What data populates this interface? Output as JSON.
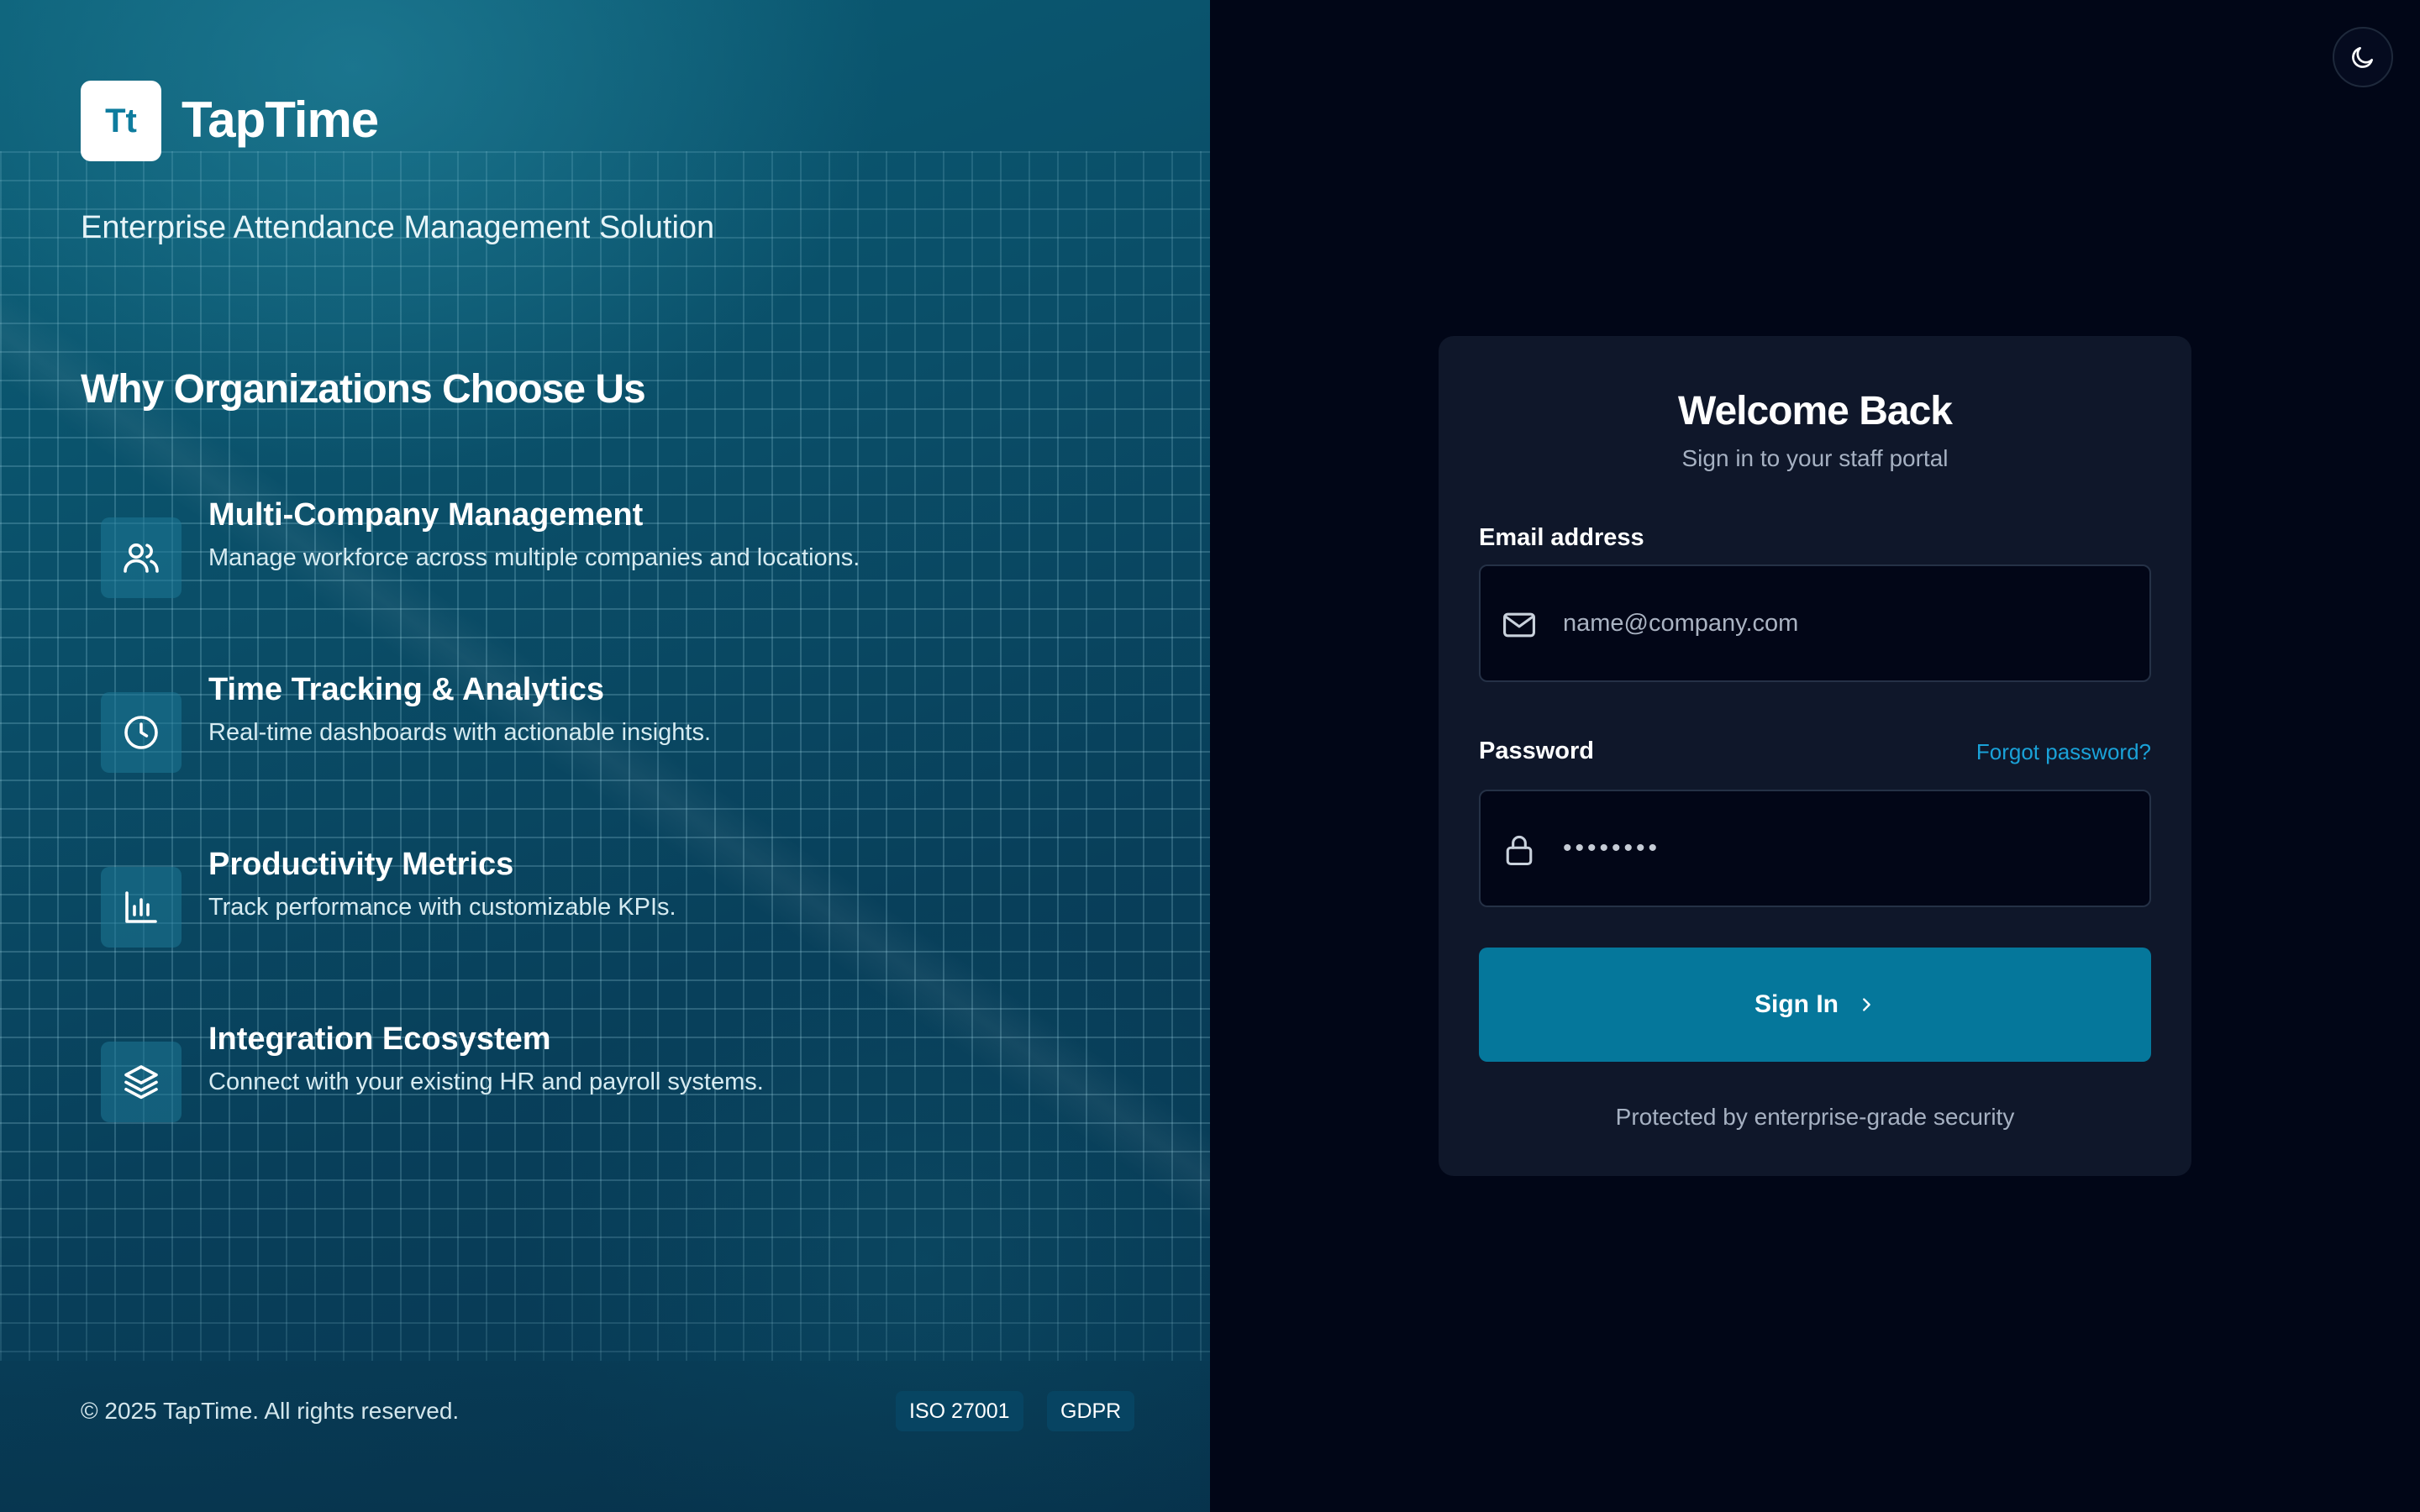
{
  "brand": {
    "logo_initials": "Tt",
    "name": "TapTime",
    "tagline": "Enterprise Attendance Management Solution"
  },
  "features_heading": "Why Organizations Choose Us",
  "features": [
    {
      "icon": "users-icon",
      "title": "Multi-Company Management",
      "description": "Manage workforce across multiple companies and locations."
    },
    {
      "icon": "clock-icon",
      "title": "Time Tracking & Analytics",
      "description": "Real-time dashboards with actionable insights."
    },
    {
      "icon": "bar-chart-icon",
      "title": "Productivity Metrics",
      "description": "Track performance with customizable KPIs."
    },
    {
      "icon": "layers-icon",
      "title": "Integration Ecosystem",
      "description": "Connect with your existing HR and payroll systems."
    }
  ],
  "footer": {
    "copyright": "© 2025 TapTime. All rights reserved.",
    "badges": [
      "ISO 27001",
      "GDPR"
    ]
  },
  "theme_toggle": {
    "icon": "moon-icon"
  },
  "login": {
    "title": "Welcome Back",
    "subtitle": "Sign in to your staff portal",
    "email_label": "Email address",
    "email_placeholder": "name@company.com",
    "password_label": "Password",
    "forgot_password": "Forgot password?",
    "password_value": "••••••••",
    "submit_label": "Sign In",
    "security_note": "Protected by enterprise-grade security"
  },
  "colors": {
    "accent": "#05779b",
    "link": "#1aa2d8",
    "card_bg": "#0f172a",
    "page_bg": "#010617"
  }
}
